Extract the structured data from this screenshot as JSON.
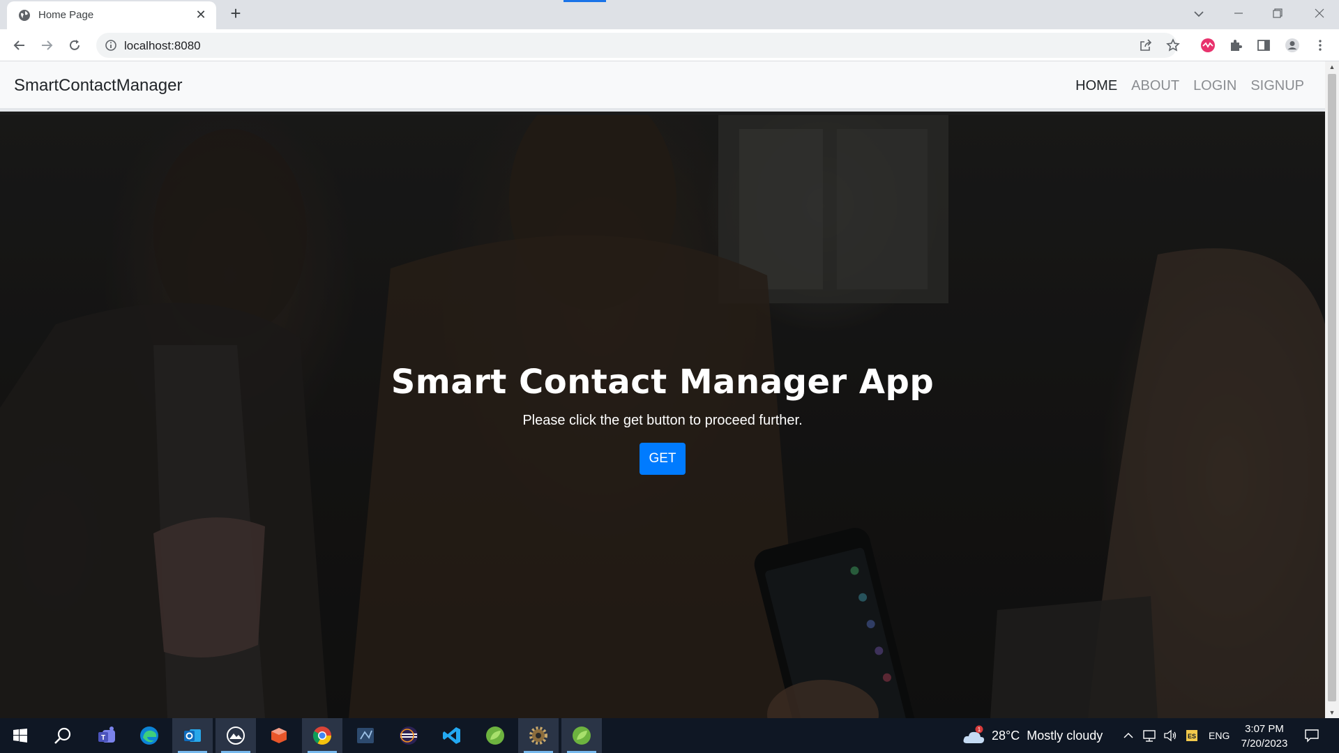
{
  "browser": {
    "tab_title": "Home Page",
    "url": "localhost:8080"
  },
  "navbar": {
    "brand": "SmartContactManager",
    "links": [
      {
        "label": "HOME",
        "active": true
      },
      {
        "label": "ABOUT",
        "active": false
      },
      {
        "label": "LOGIN",
        "active": false
      },
      {
        "label": "SIGNUP",
        "active": false
      }
    ]
  },
  "hero": {
    "title": "Smart Contact Manager App",
    "subtitle": "Please click the get button to proceed further.",
    "button_label": "GET",
    "button_color": "#007bff"
  },
  "taskbar": {
    "apps": [
      "windows-start-icon",
      "search-icon",
      "teams-icon",
      "edge-icon",
      "outlook-icon",
      "photos-icon",
      "office-icon",
      "chrome-icon",
      "ide-icon",
      "eclipse-icon",
      "vscode-icon",
      "spring-tools-icon",
      "settings-gear-icon",
      "spring-tools-icon"
    ],
    "weather": {
      "temperature": "28°C",
      "condition": "Mostly cloudy",
      "alert_count": "1"
    },
    "language": "ENG",
    "time": "3:07 PM",
    "date": "7/20/2023"
  }
}
